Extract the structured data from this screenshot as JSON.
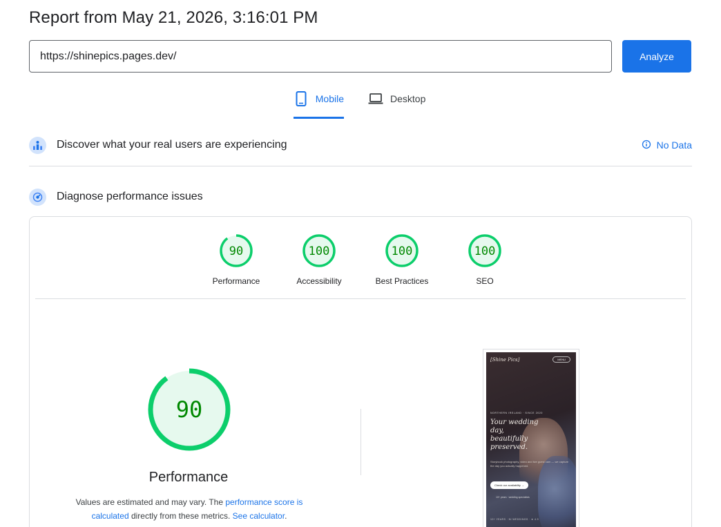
{
  "header": {
    "title": "Report from May 21, 2026, 3:16:01 PM"
  },
  "search": {
    "url_value": "https://shinepics.pages.dev/",
    "analyze_label": "Analyze"
  },
  "tabs": [
    {
      "label": "Mobile",
      "active": true,
      "icon": "smartphone-icon"
    },
    {
      "label": "Desktop",
      "active": false,
      "icon": "laptop-icon"
    }
  ],
  "crux": {
    "title": "Discover what your real users are experiencing",
    "icon": "users-chart-icon",
    "status_label": "No Data",
    "status_icon": "info-icon"
  },
  "diagnose": {
    "title": "Diagnose performance issues",
    "icon": "speedometer-icon"
  },
  "scores": [
    {
      "label": "Performance",
      "value": "90",
      "fraction": 0.9
    },
    {
      "label": "Accessibility",
      "value": "100",
      "fraction": 1.0
    },
    {
      "label": "Best Practices",
      "value": "100",
      "fraction": 1.0
    },
    {
      "label": "SEO",
      "value": "100",
      "fraction": 1.0
    }
  ],
  "performance": {
    "score": "90",
    "fraction": 0.9,
    "title": "Performance",
    "desc_prefix": "Values are estimated and may vary. The ",
    "desc_link1": "performance score is calculated",
    "desc_middle": " directly from these metrics. ",
    "desc_link2": "See calculator",
    "desc_suffix": "."
  },
  "colors": {
    "accent": "#1a73e8",
    "pass_green": "#0cce6b",
    "pass_green_text": "#008800",
    "pass_green_bg": "#e6f9ee"
  }
}
